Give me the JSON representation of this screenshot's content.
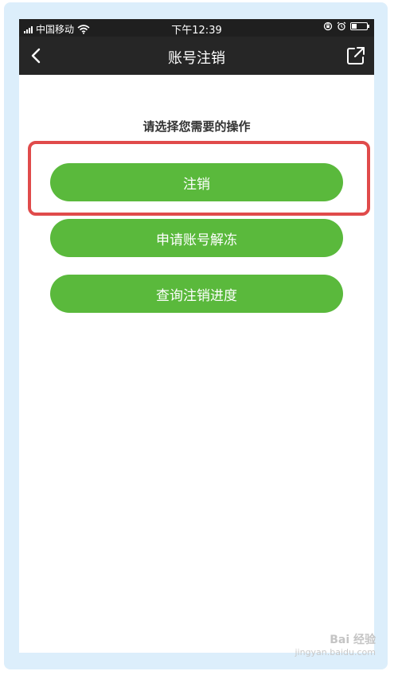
{
  "status_bar": {
    "carrier": "中国移动",
    "time": "下午12:39",
    "battery_level": 0.35
  },
  "nav": {
    "title": "账号注销",
    "back_icon": "chevron-left-icon",
    "share_icon": "share-external-icon"
  },
  "main": {
    "section_title": "请选择您需要的操作",
    "buttons": [
      {
        "label": "注销"
      },
      {
        "label": "申请账号解冻"
      },
      {
        "label": "查询注销进度"
      }
    ]
  },
  "colors": {
    "button_green": "#5ab93c",
    "highlight_red": "#e04b4b",
    "nav_bg": "#262626"
  },
  "watermark": {
    "text": "Bai 经验",
    "url": "jingyan.baidu.com"
  }
}
